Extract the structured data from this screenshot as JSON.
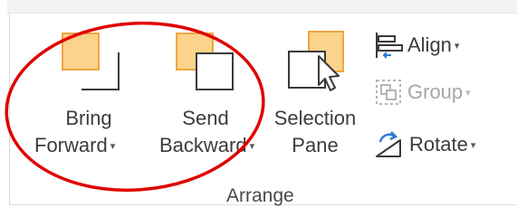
{
  "group": {
    "label": "Arrange",
    "bring_forward": {
      "line1": "Bring",
      "line2": "Forward",
      "icon": "bring-forward-icon"
    },
    "send_backward": {
      "line1": "Send",
      "line2": "Backward",
      "icon": "send-backward-icon"
    },
    "selection_pane": {
      "line1": "Selection",
      "line2": "Pane",
      "icon": "selection-pane-icon"
    },
    "align": {
      "label": "Align",
      "icon": "align-icon"
    },
    "group_btn": {
      "label": "Group",
      "icon": "group-icon",
      "enabled": false
    },
    "rotate": {
      "label": "Rotate",
      "icon": "rotate-icon"
    }
  },
  "annotation": {
    "color": "#e00000",
    "shape": "ellipse"
  },
  "caret_glyph": "▾"
}
